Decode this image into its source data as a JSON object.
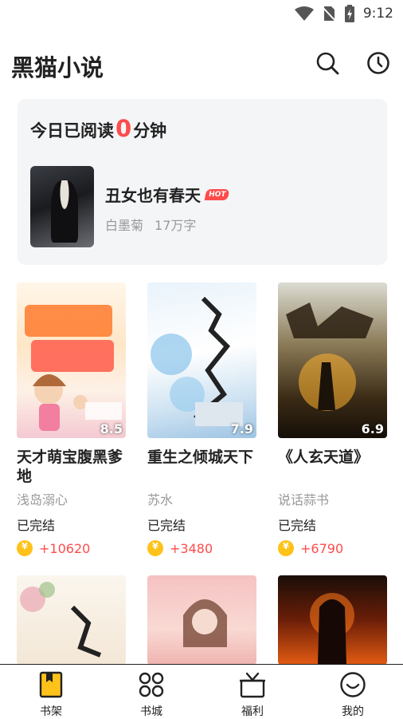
{
  "status_bar": {
    "time": "9:12"
  },
  "header": {
    "title": "黑猫小说"
  },
  "reading": {
    "prefix": "今日已阅读",
    "minutes": "0",
    "suffix": "分钟",
    "recent_book": {
      "title": "丑女也有春天",
      "badge": "HOT",
      "author": "白墨菊",
      "words": "17万字"
    }
  },
  "books": [
    {
      "title": "天才萌宝腹黑爹地",
      "author": "浅岛溺心",
      "status": "已完结",
      "coins": "+10620",
      "score": "8.5"
    },
    {
      "title": "重生之倾城天下",
      "author": "苏水",
      "status": "已完结",
      "coins": "+3480",
      "score": "7.9"
    },
    {
      "title": "《人玄天道》",
      "author": "说话蒜书",
      "status": "已完结",
      "coins": "+6790",
      "score": "6.9"
    }
  ],
  "tabs": [
    {
      "label": "书架",
      "icon": "bookshelf-icon"
    },
    {
      "label": "书城",
      "icon": "bookstore-icon"
    },
    {
      "label": "福利",
      "icon": "gift-icon"
    },
    {
      "label": "我的",
      "icon": "profile-icon"
    }
  ],
  "colors": {
    "accent": "#ff4b4b",
    "coin": "#ffc21a",
    "tab_active": "#ffc21a"
  }
}
